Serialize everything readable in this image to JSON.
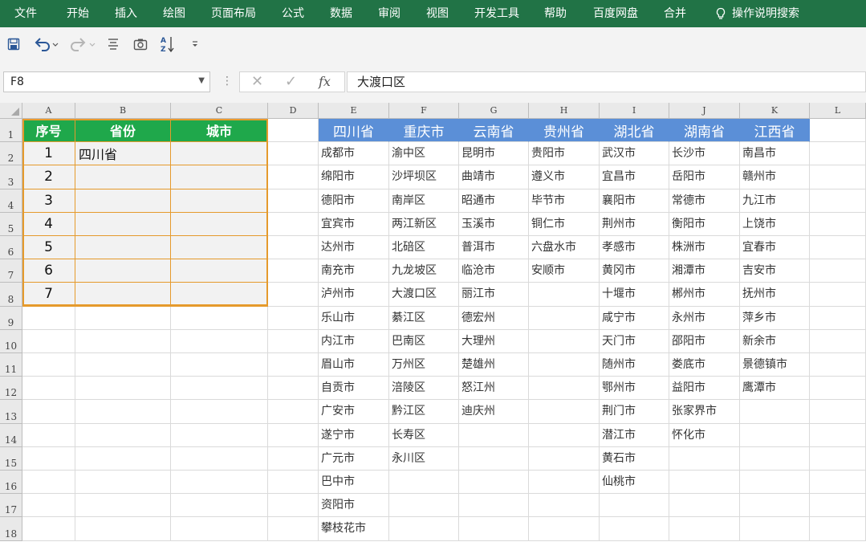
{
  "ribbon": {
    "tabs": [
      "文件",
      "开始",
      "插入",
      "绘图",
      "页面布局",
      "公式",
      "数据",
      "审阅",
      "视图",
      "开发工具",
      "帮助",
      "百度网盘",
      "合并"
    ],
    "help_search": "操作说明搜索"
  },
  "toolbar": {
    "icons": [
      "save-icon",
      "undo-icon",
      "redo-icon",
      "align-icon",
      "camera-icon",
      "sort-icon",
      "customize-icon"
    ]
  },
  "formula_bar": {
    "name_box": "F8",
    "formula": "大渡口区",
    "fx_label": "fx"
  },
  "grid": {
    "columns": [
      "A",
      "B",
      "C",
      "D",
      "E",
      "F",
      "G",
      "H",
      "I",
      "J",
      "K",
      "L"
    ],
    "rows": [
      "1",
      "2",
      "3",
      "4",
      "5",
      "6",
      "7",
      "8",
      "9",
      "10",
      "11",
      "12",
      "13",
      "14",
      "15",
      "16",
      "17",
      "18"
    ],
    "left_table": {
      "headers": [
        "序号",
        "省份",
        "城市"
      ],
      "numbers": [
        "1",
        "2",
        "3",
        "4",
        "5",
        "6",
        "7"
      ],
      "first_province": "四川省"
    },
    "provinces": [
      {
        "name": "四川省",
        "cities": [
          "成都市",
          "绵阳市",
          "德阳市",
          "宜宾市",
          "达州市",
          "南充市",
          "泸州市",
          "乐山市",
          "内江市",
          "眉山市",
          "自贡市",
          "广安市",
          "遂宁市",
          "广元市",
          "巴中市",
          "资阳市",
          "攀枝花市"
        ]
      },
      {
        "name": "重庆市",
        "cities": [
          "渝中区",
          "沙坪坝区",
          "南岸区",
          "两江新区",
          "北碚区",
          "九龙坡区",
          "大渡口区",
          "綦江区",
          "巴南区",
          "万州区",
          "涪陵区",
          "黔江区",
          "长寿区",
          "永川区"
        ]
      },
      {
        "name": "云南省",
        "cities": [
          "昆明市",
          "曲靖市",
          "昭通市",
          "玉溪市",
          "普洱市",
          "临沧市",
          "丽江市",
          "德宏州",
          "大理州",
          "楚雄州",
          "怒江州",
          "迪庆州"
        ]
      },
      {
        "name": "贵州省",
        "cities": [
          "贵阳市",
          "遵义市",
          "毕节市",
          "铜仁市",
          "六盘水市",
          "安顺市"
        ]
      },
      {
        "name": "湖北省",
        "cities": [
          "武汉市",
          "宜昌市",
          "襄阳市",
          "荆州市",
          "孝感市",
          "黄冈市",
          "十堰市",
          "咸宁市",
          "天门市",
          "随州市",
          "鄂州市",
          "荆门市",
          "潜江市",
          "黄石市",
          "仙桃市"
        ]
      },
      {
        "name": "湖南省",
        "cities": [
          "长沙市",
          "岳阳市",
          "常德市",
          "衡阳市",
          "株洲市",
          "湘潭市",
          "郴州市",
          "永州市",
          "邵阳市",
          "娄底市",
          "益阳市",
          "张家界市",
          "怀化市"
        ]
      },
      {
        "name": "江西省",
        "cities": [
          "南昌市",
          "赣州市",
          "九江市",
          "上饶市",
          "宜春市",
          "吉安市",
          "抚州市",
          "萍乡市",
          "新余市",
          "景德镇市",
          "鹰潭市"
        ]
      }
    ]
  },
  "colors": {
    "ribbon": "#217346",
    "table_header": "#1fa84b",
    "table_border": "#e59a2c",
    "province_header": "#5b8fd7"
  }
}
